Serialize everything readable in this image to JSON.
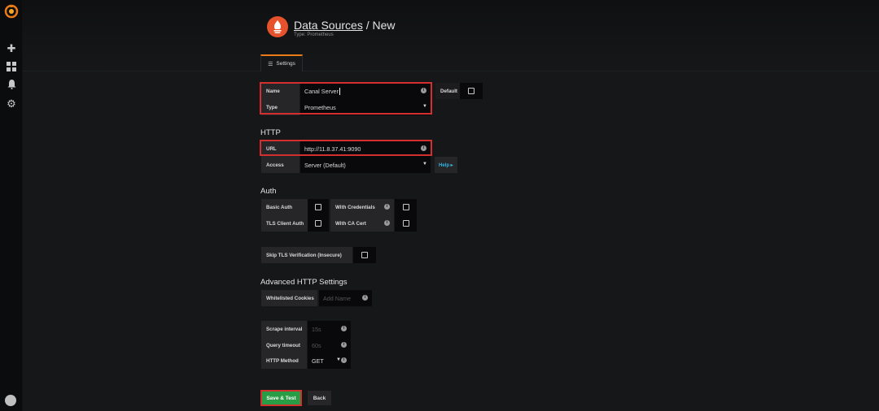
{
  "colors": {
    "brand_orange": "#eb7b18",
    "prometheus_red": "#e6522c",
    "highlight_red": "#d32f2f",
    "save_green": "#299c46",
    "help_blue": "#33b5e5"
  },
  "sidebar": {
    "icons": [
      "grafana-logo",
      "plus-icon",
      "dashboards-icon",
      "bell-icon",
      "gear-icon",
      "avatar"
    ]
  },
  "header": {
    "crumb": "Data Sources",
    "title_suffix": " / New",
    "subtitle": "Type: Prometheus"
  },
  "tabs": [
    {
      "label": "Settings",
      "icon": "sliders-icon"
    }
  ],
  "settings": {
    "name_label": "Name",
    "name_value": "Canal Server",
    "default_label": "Default",
    "type_label": "Type",
    "type_value": "Prometheus"
  },
  "http": {
    "title": "HTTP",
    "url_label": "URL",
    "url_value": "http://11.8.37.41:9090",
    "access_label": "Access",
    "access_value": "Server (Default)",
    "help_label": "Help ▸"
  },
  "auth": {
    "title": "Auth",
    "basic_auth": "Basic Auth",
    "with_credentials": "With Credentials",
    "tls_client_auth": "TLS Client Auth",
    "with_ca_cert": "With CA Cert",
    "skip_tls": "Skip TLS Verification (Insecure)"
  },
  "advanced": {
    "title": "Advanced HTTP Settings",
    "whitelisted_label": "Whitelisted Cookies",
    "whitelisted_placeholder": "Add Name"
  },
  "prom": {
    "scrape_label": "Scrape interval",
    "scrape_placeholder": "15s",
    "timeout_label": "Query timeout",
    "timeout_placeholder": "60s",
    "method_label": "HTTP Method",
    "method_value": "GET"
  },
  "actions": {
    "save": "Save & Test",
    "back": "Back"
  }
}
